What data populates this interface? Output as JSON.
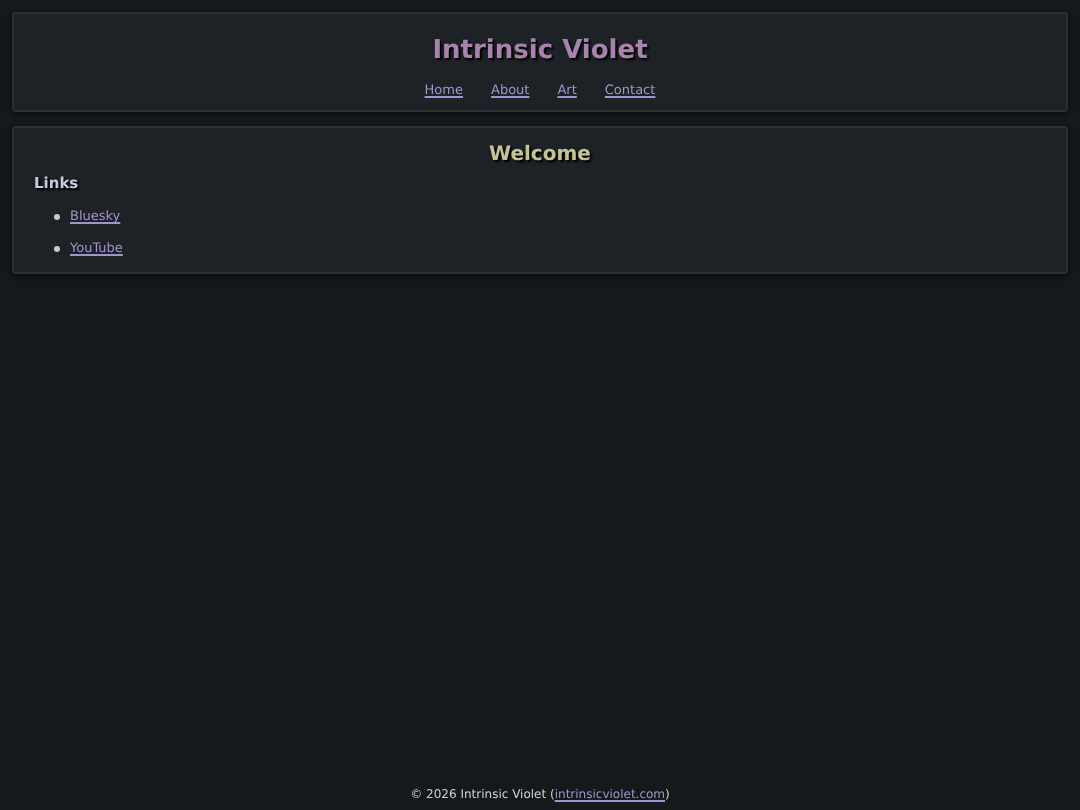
{
  "header": {
    "title": "Intrinsic Violet",
    "nav": [
      "Home",
      "About",
      "Art",
      "Contact"
    ]
  },
  "main": {
    "heading": "Welcome",
    "links_heading": "Links",
    "links": [
      "Bluesky",
      "YouTube"
    ]
  },
  "footer": {
    "prefix": "© 2026 Intrinsic Violet (",
    "link": "intrinsicviolet.com",
    "suffix": ")"
  }
}
